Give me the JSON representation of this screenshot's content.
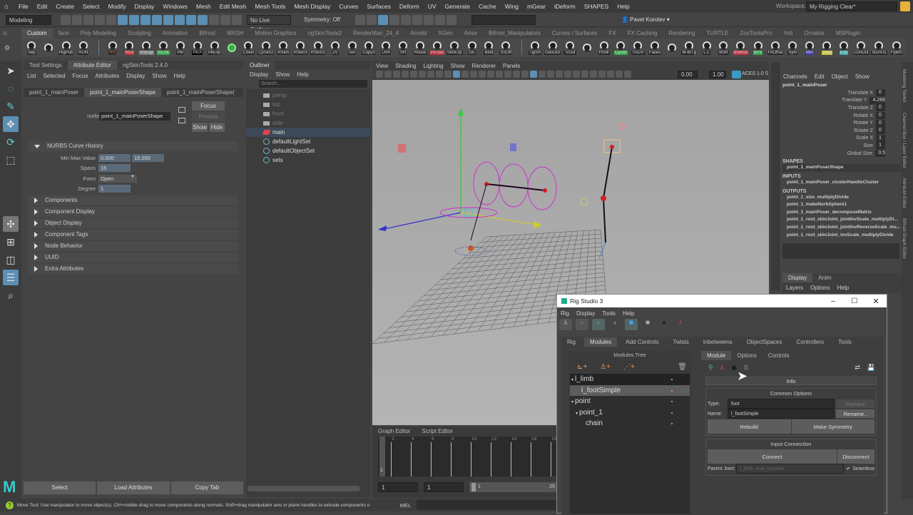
{
  "menubar": {
    "items": [
      "File",
      "Edit",
      "Create",
      "Select",
      "Modify",
      "Display",
      "Windows",
      "Mesh",
      "Edit Mesh",
      "Mesh Tools",
      "Mesh Display",
      "Curves",
      "Surfaces",
      "Deform",
      "UV",
      "Generate",
      "Cache",
      "Wing",
      "mGear",
      "iDeform",
      "SHAPES",
      "Help"
    ],
    "workspace_label": "Workspace:",
    "workspace_value": "My Rigging Clear*"
  },
  "statusline": {
    "mode": "Modeling",
    "live_surface": "No Live Surface",
    "symmetry": "Symmetry: Off",
    "user": "Pavel Korolev"
  },
  "shelf": {
    "tabs": [
      "Custom",
      "face",
      "Poly Modeling",
      "Sculpting",
      "Animation",
      "Bifrost",
      "MASH",
      "Motion Graphics",
      "ngSkinTools2",
      "RenderMan_24_4",
      "Arnold",
      "XGen",
      "Arise",
      "Bifrost_Manipulators",
      "Curves / Surfaces",
      "FX",
      "FX Caching",
      "Rendering",
      "TURTLE",
      "ZooToolsPro",
      "Yeti",
      "Ornatrix",
      "MSPlugin"
    ],
    "buttons": [
      {
        "label": "Sep"
      },
      {
        "label": ""
      },
      {
        "label": "RigPub"
      },
      {
        "label": "RUN"
      },
      {
        "label": "|"
      },
      {
        "label": "RS",
        "color": "#e07020"
      },
      {
        "label": "RS3",
        "bg": "#c0303a"
      },
      {
        "label": "RSExp",
        "bg": "#777"
      },
      {
        "label": "mChk",
        "bg": "#2fa84a"
      },
      {
        "label": "Pkr"
      },
      {
        "label": "PkrA",
        "bg": "#000"
      },
      {
        "label": "PkExp"
      },
      {
        "label": "",
        "bg": "#3aa84a"
      },
      {
        "label": "CSkin"
      },
      {
        "label": "CpSkn2"
      },
      {
        "label": "RSkin"
      },
      {
        "label": "RSkin3"
      },
      {
        "label": "RSkin3"
      },
      {
        "label": "ZV"
      },
      {
        "label": "Set"
      },
      {
        "label": "CopyS"
      },
      {
        "label": "LRA"
      },
      {
        "label": "SH"
      },
      {
        "label": "House"
      },
      {
        "label": "PxTool",
        "bg": "#c0303a"
      },
      {
        "label": "SknExp"
      },
      {
        "label": "GE"
      },
      {
        "label": "Bind"
      },
      {
        "label": "SSOff"
      },
      {
        "label": "|"
      },
      {
        "label": "TglSh"
      },
      {
        "label": "GeoOut"
      },
      {
        "label": "TrOut"
      },
      {
        "label": ""
      },
      {
        "label": "HSW"
      },
      {
        "label": "Cycler",
        "bg": "#2fa84a"
      },
      {
        "label": "TrsUV"
      },
      {
        "label": "Faces"
      },
      {
        "label": ""
      },
      {
        "label": "M-BITg"
      },
      {
        "label": "L-L"
      },
      {
        "label": "BSR"
      },
      {
        "label": "BSRrId",
        "bg": "#c0303a"
      },
      {
        "label": "IkFk",
        "bg": "#2fa84a"
      },
      {
        "label": "FkOffse"
      },
      {
        "label": "Sym"
      },
      {
        "label": "Mirr",
        "bg": "#3a3ab0"
      },
      {
        "label": "Time",
        "bg": "#c8c840"
      },
      {
        "label": "Exp",
        "bg": "#3aa8a8"
      },
      {
        "label": "ConOut"
      },
      {
        "label": "SlUnUs"
      },
      {
        "label": "FlpBS"
      }
    ]
  },
  "attr": {
    "tabs": [
      "Tool Settings",
      "Attribute Editor",
      "ngSkinTools 2.4.0"
    ],
    "menu": [
      "List",
      "Selected",
      "Focus",
      "Attributes",
      "Display",
      "Show",
      "Help"
    ],
    "node_tabs": [
      "point_1_mainPoser",
      "point_1_mainPoserShape",
      "point_1_mainPoserShape("
    ],
    "node_label": "nurbsCurve:",
    "node_value": "point_1_mainPoserShape",
    "focus": "Focus",
    "presets": "Presets",
    "show": "Show",
    "hide": "Hide",
    "history_title": "NURBS Curve History",
    "minmax_label": "Min Max Value",
    "min": "0.000",
    "max": "15.000",
    "spans_label": "Spans",
    "spans": "15",
    "form_label": "Form",
    "form": "Open",
    "degree_label": "Degree",
    "degree": "1",
    "sections": [
      "Components",
      "Component Display",
      "Object Display",
      "Component Tags",
      "Node Behavior",
      "UUID",
      "Extra Attributes"
    ],
    "select": "Select",
    "load": "Load Attributes",
    "copy": "Copy Tab"
  },
  "outliner": {
    "title": "Outliner",
    "menu": [
      "Display",
      "Show",
      "Help"
    ],
    "search_placeholder": "Search...",
    "items": [
      {
        "label": "persp",
        "type": "cam"
      },
      {
        "label": "top",
        "type": "cam"
      },
      {
        "label": "front",
        "type": "cam"
      },
      {
        "label": "side",
        "type": "cam"
      },
      {
        "label": "main",
        "type": "main"
      },
      {
        "label": "defaultLightSet",
        "type": "set"
      },
      {
        "label": "defaultObjectSet",
        "type": "set"
      },
      {
        "label": "sets",
        "type": "set"
      }
    ]
  },
  "viewport": {
    "menu": [
      "View",
      "Shading",
      "Lighting",
      "Show",
      "Renderer",
      "Panels"
    ],
    "exposure": "0.00",
    "gamma": "1.00",
    "colorspace": "ACES 1.0 S"
  },
  "timeline": {
    "tabs": [
      "Graph Editor",
      "Script Editor"
    ],
    "ticks": [
      "2",
      "4",
      "6",
      "8",
      "10",
      "12",
      "14",
      "16",
      "18"
    ],
    "current": "1",
    "start": "1",
    "range_start": "1",
    "slider_start": "1",
    "slider_end": "25"
  },
  "channels": {
    "menu": [
      "Channels",
      "Edit",
      "Object",
      "Show"
    ],
    "node": "point_1_mainPoser",
    "attrs": [
      {
        "n": "Translate X",
        "v": "0"
      },
      {
        "n": "Translate Y",
        "v": "4.266"
      },
      {
        "n": "Translate Z",
        "v": "0"
      },
      {
        "n": "Rotate X",
        "v": "0"
      },
      {
        "n": "Rotate Y",
        "v": "0"
      },
      {
        "n": "Rotate Z",
        "v": "0"
      },
      {
        "n": "Scale X",
        "v": "1"
      },
      {
        "n": "Size",
        "v": "1"
      },
      {
        "n": "Global Size",
        "v": "0.5"
      }
    ],
    "shapes_h": "SHAPES",
    "shapes": [
      "point_1_mainPoserShape"
    ],
    "inputs_h": "INPUTS",
    "inputs": [
      "point_1_mainPoser_clusterHandleCluster"
    ],
    "outputs_h": "OUTPUTS",
    "outputs": [
      "point_1_size_multiplyDivide",
      "point_1_makeNurbSphere1",
      "point_1_mainPoser_decomposeMatrix",
      "point_1_root_skinJoint_jointInvScale_multiplyDi...",
      "point_1_root_skinJoint_jointInvReverseScale_mu...",
      "point_1_root_skinJoint_invScale_multiplyDivide"
    ],
    "layer_tabs": [
      "Display",
      "Anim"
    ],
    "layer_menu": [
      "Layers",
      "Options",
      "Help"
    ],
    "side_tabs": [
      "Modeling Toolkit",
      "Channel Box / Layer Editor",
      "Attribute Editor",
      "Bifrost Graph Editor"
    ]
  },
  "rigstudio": {
    "title": "Rig Studio 3",
    "menu": [
      "Rig",
      "Display",
      "Tools",
      "Help"
    ],
    "tabs": [
      "Rig",
      "Modules",
      "Add Controls",
      "Twists",
      "Inbetweens",
      "ObjectSpaces",
      "Controllers",
      "Tools"
    ],
    "tree_title": "Modules Tree",
    "tree": [
      {
        "label": "l_limb",
        "depth": 0,
        "arrow": true
      },
      {
        "label": "l_footSimple",
        "depth": 1,
        "arrow": false,
        "sel": true
      },
      {
        "label": "point",
        "depth": 0,
        "arrow": true
      },
      {
        "label": "point_1",
        "depth": 1,
        "arrow": true
      },
      {
        "label": "chain",
        "depth": 2,
        "arrow": false
      }
    ],
    "subtabs": [
      "Module",
      "Options",
      "Controls"
    ],
    "info": "Info",
    "common": "Common Options",
    "type_label": "Type:",
    "type": "foot",
    "replace": "Replace",
    "name_label": "Name:",
    "name": "l_footSimple",
    "rename": "Rename..",
    "rebuild": "Rebuild",
    "symmetry": "Make Symmetry",
    "input": "Input Connection",
    "connect": "Connect",
    "disconnect": "Disconnect",
    "parent_label": "Parent Joint",
    "parent": "l_limb_end_outJoint",
    "seamless": "Seamless",
    "s_icon": "S"
  },
  "helpline": {
    "text": "Move Tool: Use manipulator to move object(s). Ctrl+middle-drag to move components along normals. Shift+drag manipulator axis or plane handles to extrude components o",
    "mel": "MEL"
  }
}
